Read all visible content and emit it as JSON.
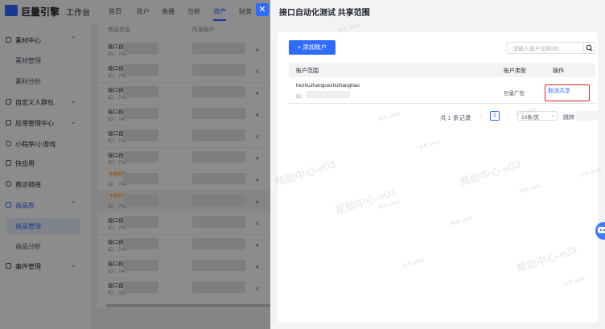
{
  "app": {
    "brand": "巨量引擎",
    "workbench": "工作台"
  },
  "topnav": [
    "首页",
    "账户",
    "直播",
    "分析",
    "资产",
    "财务"
  ],
  "topnav_active": "资产",
  "sidebar": {
    "items": [
      {
        "label": "素材中心",
        "type": "group",
        "chevron": "⌃"
      },
      {
        "label": "素材管理",
        "type": "sub"
      },
      {
        "label": "素材分析",
        "type": "sub"
      },
      {
        "label": "自定义人群包",
        "type": "group",
        "chevron": "⌄"
      },
      {
        "label": "应用管理中心",
        "type": "group",
        "chevron": "⌄"
      },
      {
        "label": "小程序/小游戏",
        "type": "item"
      },
      {
        "label": "快应用",
        "type": "item"
      },
      {
        "label": "直达链接",
        "type": "item"
      },
      {
        "label": "商品库",
        "type": "group",
        "chevron": "⌃"
      },
      {
        "label": "商品管理",
        "type": "sub"
      },
      {
        "label": "商品分析",
        "type": "sub"
      },
      {
        "label": "事件管理",
        "type": "group",
        "chevron": "⌄"
      }
    ],
    "selected": "商品管理"
  },
  "product_table": {
    "headers": [
      "商品信息",
      "所属账户"
    ],
    "rows": [
      {
        "name": "接口自动",
        "id": "ID：742",
        "acct_suffix": "4"
      },
      {
        "name": "接口自动",
        "id": "ID：742",
        "acct_suffix": "4"
      },
      {
        "name": "接口自动",
        "id": "ID：741",
        "acct_suffix": "4"
      },
      {
        "name": "接口自动",
        "id": "ID：741",
        "acct_suffix": "4"
      },
      {
        "name": "接口自动",
        "id": "ID：741",
        "acct_suffix": "4"
      },
      {
        "name": "接口自动",
        "id": "ID：741",
        "acct_suffix": "4"
      },
      {
        "name": "",
        "tag": "不投放中",
        "id": "ID：740",
        "acct_suffix": "4"
      },
      {
        "name": "",
        "tag": "不投放中",
        "id": "ID：740",
        "acct_suffix": "4"
      },
      {
        "name": "接口自动",
        "id": "ID：740",
        "acct_suffix": "4"
      },
      {
        "name": "接口自动",
        "id": "ID：740",
        "acct_suffix": "4"
      },
      {
        "name": "接口自动",
        "id": "ID：740",
        "acct_suffix": "4"
      },
      {
        "name": "接口自动",
        "id": "ID：335",
        "acct_suffix": "4"
      }
    ]
  },
  "drawer": {
    "title": "接口自动化测试 共享范围",
    "add_button": "+ 添加账户",
    "search_placeholder": "请输入账户名称/ID",
    "columns": {
      "range": "账户范围",
      "type": "账户类型",
      "action": "操作"
    },
    "rows": [
      {
        "account_name": "hezhuzhangceshizhanghao",
        "account_id_prefix": "ID：1",
        "account_type": "巨量广告",
        "action": "取消共享"
      }
    ],
    "pagination": {
      "total": "共 1 条记录",
      "prev": "‹",
      "current_page": "1",
      "next": "›",
      "page_size": "10条/页",
      "jump_label": "跳转"
    }
  },
  "watermarks": {
    "large": "帮助中心-e03",
    "small": "字节 3604"
  },
  "colors": {
    "accent": "#2f6bff",
    "highlight_box": "#e02020"
  }
}
